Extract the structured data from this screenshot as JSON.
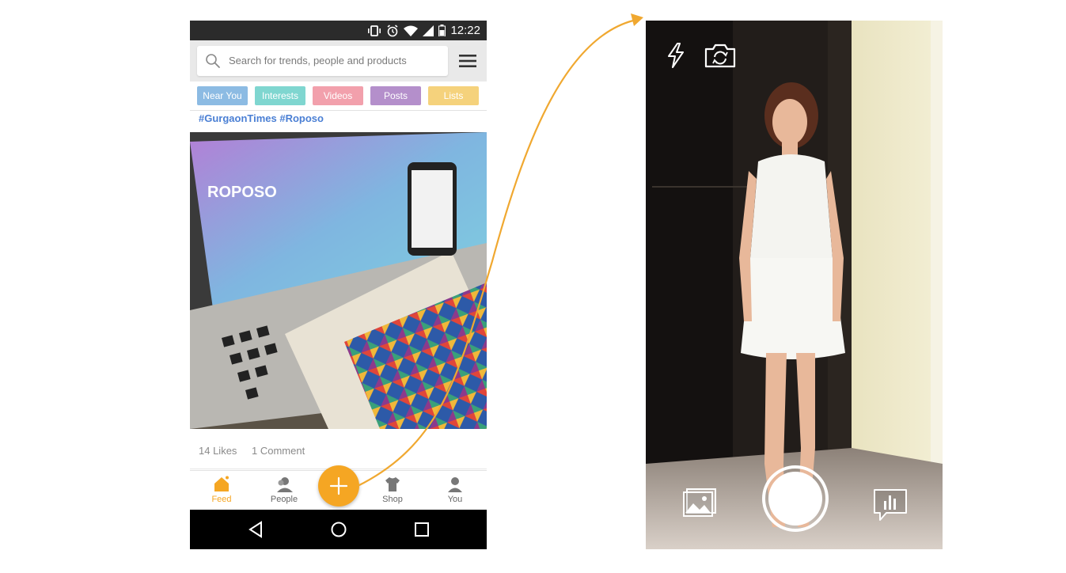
{
  "status_bar": {
    "time": "12:22"
  },
  "search": {
    "placeholder": "Search for trends, people and products"
  },
  "filters": [
    {
      "label": "Near You",
      "color": "#8cbbe3"
    },
    {
      "label": "Interests",
      "color": "#7fd6d0"
    },
    {
      "label": "Videos",
      "color": "#f2a0ac"
    },
    {
      "label": "Posts",
      "color": "#b48fcb"
    },
    {
      "label": "Lists",
      "color": "#f5d27c"
    }
  ],
  "post": {
    "hashtags": "#GurgaonTimes #Roposo",
    "image_brand_text": "ROPOSO",
    "likes": "14 Likes",
    "comments": "1 Comment"
  },
  "bottom_nav": {
    "feed": "Feed",
    "people": "People",
    "shop": "Shop",
    "you": "You"
  },
  "colors": {
    "accent": "#f5a623",
    "arrow": "#f0a830",
    "hashtag": "#4a7fd4"
  },
  "camera": {
    "icons": [
      "flash-icon",
      "switch-camera-icon",
      "gallery-icon",
      "shutter-button",
      "stats-icon"
    ]
  }
}
